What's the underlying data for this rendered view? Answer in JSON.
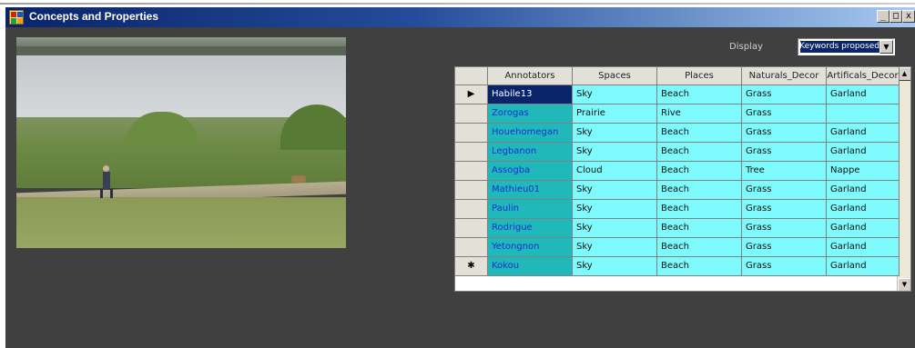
{
  "window": {
    "title": "Concepts and Properties",
    "controls": {
      "minimize": "_",
      "maximize": "□",
      "close": "x"
    }
  },
  "display": {
    "label": "Display",
    "selected": "Keywords proposed"
  },
  "grid": {
    "columns": [
      "Annotators",
      "Spaces",
      "Places",
      "Naturals_Decor",
      "Artificals_Decor"
    ],
    "rows": [
      {
        "marker": "▶",
        "cells": [
          "Habile13",
          "Sky",
          "Beach",
          "Grass",
          "Garland"
        ]
      },
      {
        "marker": "",
        "cells": [
          "Zorogas",
          "Prairie",
          "Rive",
          "Grass",
          ""
        ]
      },
      {
        "marker": "",
        "cells": [
          "Houehomegan",
          "Sky",
          "Beach",
          "Grass",
          "Garland"
        ]
      },
      {
        "marker": "",
        "cells": [
          "Legbanon",
          "Sky",
          "Beach",
          "Grass",
          "Garland"
        ]
      },
      {
        "marker": "",
        "cells": [
          "Assogba",
          "Cloud",
          "Beach",
          "Tree",
          "Nappe"
        ]
      },
      {
        "marker": "",
        "cells": [
          "Mathieu01",
          "Sky",
          "Beach",
          "Grass",
          "Garland"
        ]
      },
      {
        "marker": "",
        "cells": [
          "Paulin",
          "Sky",
          "Beach",
          "Grass",
          "Garland"
        ]
      },
      {
        "marker": "",
        "cells": [
          "Rodrigue",
          "Sky",
          "Beach",
          "Grass",
          "Garland"
        ]
      },
      {
        "marker": "",
        "cells": [
          "Yetongnon",
          "Sky",
          "Beach",
          "Grass",
          "Garland"
        ]
      },
      {
        "marker": "✱",
        "cells": [
          "Kokou",
          "Sky",
          "Beach",
          "Grass",
          "Garland"
        ]
      }
    ]
  },
  "colors": {
    "annotator_cell": "#20b8b8",
    "data_cell": "#7ffafc",
    "selected": "#0a246a",
    "client_bg": "#404040"
  },
  "icons": [
    "app-icon",
    "dropdown-arrow-icon",
    "scroll-up-icon",
    "scroll-down-icon",
    "scroll-left-icon",
    "scroll-right-icon"
  ]
}
